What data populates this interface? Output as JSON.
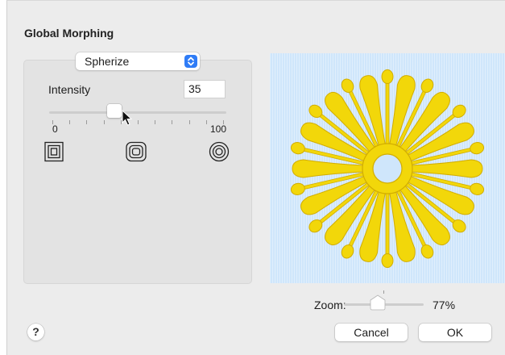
{
  "dialog": {
    "title": "Global Morphing"
  },
  "effect": {
    "selected": "Spherize"
  },
  "intensity": {
    "label": "Intensity",
    "value": "35",
    "level": 35,
    "min_label": "0",
    "max_label": "100"
  },
  "shape_icons": [
    "square-shape-icon",
    "rounded-square-shape-icon",
    "circle-shape-icon"
  ],
  "preview": {
    "background_color": "#cfe6fb",
    "design_color": "#f2d70a"
  },
  "zoom": {
    "label": "Zoom:",
    "value": "77%",
    "level": 0.5
  },
  "buttons": {
    "help": "?",
    "cancel": "Cancel",
    "ok": "OK"
  },
  "colors": {
    "accent": "#2f7cf6"
  }
}
